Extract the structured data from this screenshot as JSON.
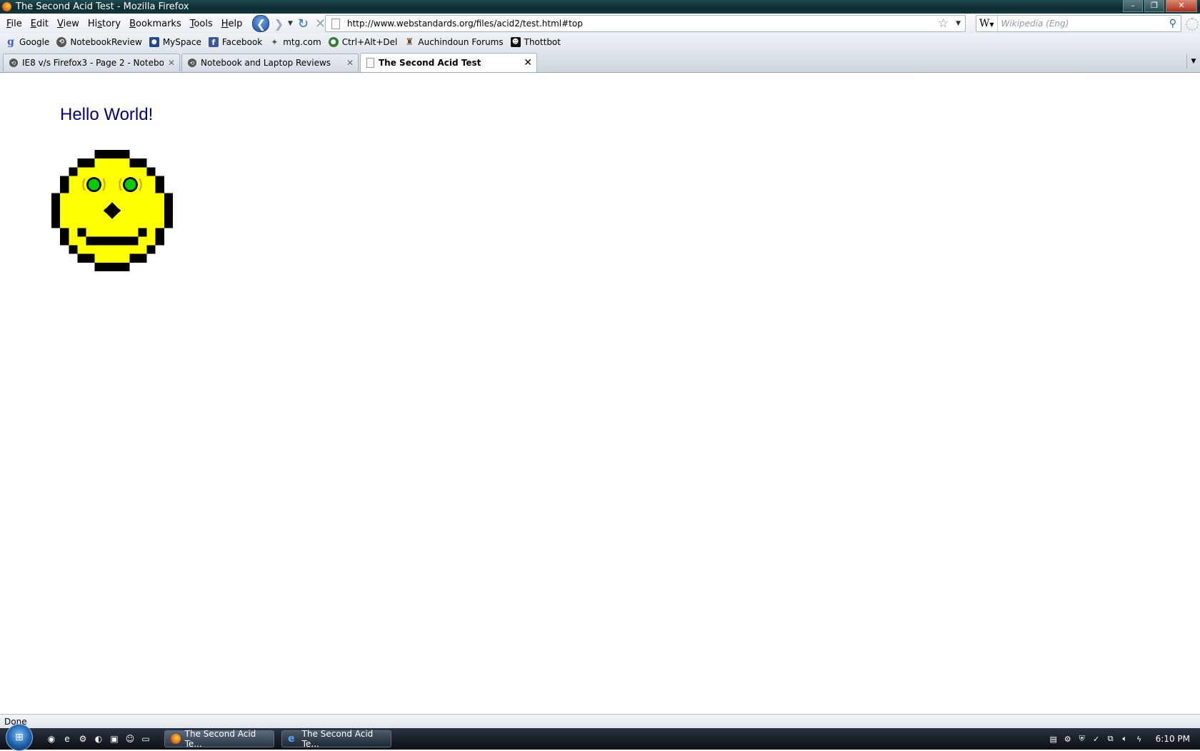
{
  "window": {
    "title": "The Second Acid Test - Mozilla Firefox",
    "minimize": "–",
    "maximize": "❐",
    "close": "✕"
  },
  "menu": {
    "file_key": "F",
    "file_rest": "ile",
    "edit_key": "E",
    "edit_rest": "dit",
    "view_key": "V",
    "view_rest": "iew",
    "history_pre": "Hi",
    "history_key": "s",
    "history_rest": "tory",
    "bookmarks_key": "B",
    "bookmarks_rest": "ookmarks",
    "tools_key": "T",
    "tools_rest": "ools",
    "help_key": "H",
    "help_rest": "elp"
  },
  "navigation": {
    "url": "http://www.webstandards.org/files/acid2/test.html#top",
    "search_engine": "W",
    "search_placeholder": "Wikipedia (Eng)"
  },
  "bookmarks": [
    {
      "label": "Google",
      "icon": "google-icon"
    },
    {
      "label": "NotebookReview",
      "icon": "notebookreview-icon"
    },
    {
      "label": "MySpace",
      "icon": "myspace-icon"
    },
    {
      "label": "Facebook",
      "icon": "facebook-icon"
    },
    {
      "label": "mtg.com",
      "icon": "mtg-icon"
    },
    {
      "label": "Ctrl+Alt+Del",
      "icon": "ctrlaltdel-icon"
    },
    {
      "label": "Auchindoun Forums",
      "icon": "auchindoun-icon"
    },
    {
      "label": "Thottbot",
      "icon": "thottbot-icon"
    }
  ],
  "tabs": [
    {
      "label": "IE8 v/s Firefox3 - Page 2 - Notebook...",
      "active": false
    },
    {
      "label": "Notebook and Laptop Reviews",
      "active": false
    },
    {
      "label": "The Second Acid Test",
      "active": true
    }
  ],
  "page": {
    "heading": "Hello World!",
    "smiley_colors": {
      "face": "#ffff00",
      "outline": "#000000",
      "eyes": "#00cc00"
    }
  },
  "status": {
    "text": "Done"
  },
  "taskbar": {
    "windows": [
      {
        "label": "The Second Acid Te...",
        "app": "firefox"
      },
      {
        "label": "The Second Acid Te...",
        "app": "internet-explorer"
      }
    ],
    "clock": "6:10 PM"
  }
}
